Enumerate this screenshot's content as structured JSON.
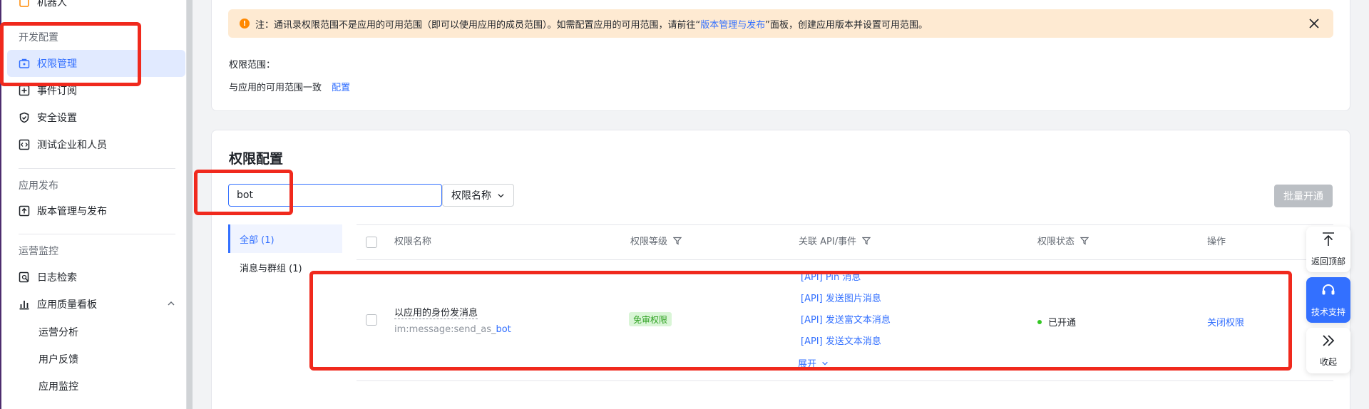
{
  "sidebar": {
    "top_item_label": "机器人",
    "dev_section": "开发配置",
    "items": [
      {
        "label": "权限管理"
      },
      {
        "label": "事件订阅"
      },
      {
        "label": "安全设置"
      },
      {
        "label": "测试企业和人员"
      }
    ],
    "release_section": "应用发布",
    "release_item": "版本管理与发布",
    "ops_section": "运营监控",
    "ops_items": [
      {
        "label": "日志检索"
      },
      {
        "label": "应用质量看板"
      }
    ],
    "sub_items": [
      "运营分析",
      "用户反馈",
      "应用监控"
    ]
  },
  "notice": {
    "prefix": "注：通讯录权限范围不是应用的可用范围（即可以使用应用的成员范围）。如需配置应用的可用范围，请前往“",
    "link": "版本管理与发布",
    "suffix": "”面板，创建应用版本并设置可用范围。"
  },
  "scope": {
    "label": "权限范围：",
    "value": "与应用的可用范围一致",
    "config_link": "配置"
  },
  "permission_config": {
    "title": "权限配置",
    "search_value": "bot",
    "filter_label": "权限名称",
    "batch_button": "批量开通",
    "categories": [
      {
        "label": "全部 (1)"
      },
      {
        "label": "消息与群组 (1)"
      }
    ],
    "columns": {
      "name": "权限名称",
      "level": "权限等级",
      "api": "关联 API/事件",
      "status": "权限状态",
      "action": "操作"
    },
    "row": {
      "name": "以应用的身份发消息",
      "code_prefix": "im:message:send_as_",
      "code_highlight": "bot",
      "level_tag": "免审权限",
      "apis": [
        "[API] Pin 消息",
        "[API] 发送图片消息",
        "[API] 发送富文本消息",
        "[API] 发送文本消息"
      ],
      "expand": "展开",
      "status": "已开通",
      "action": "关闭权限"
    }
  },
  "float_toolbar": {
    "back_top": "返回顶部",
    "support": "技术支持",
    "collapse": "收起"
  },
  "colors": {
    "accent": "#3370ff",
    "highlight_box": "#f0291d",
    "notice_bg": "#feead2",
    "status_green": "#34c724"
  }
}
